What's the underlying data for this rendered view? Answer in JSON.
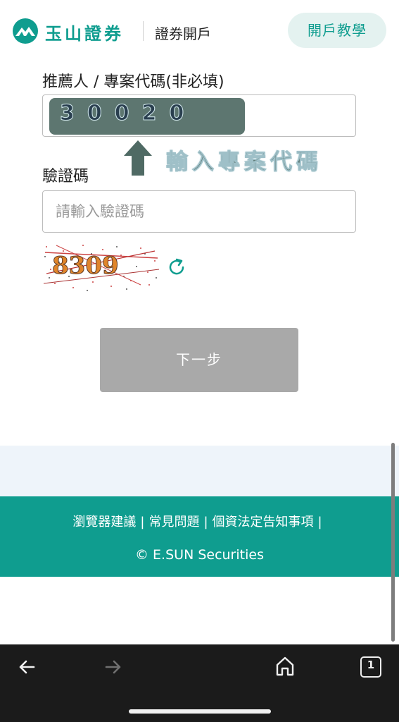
{
  "header": {
    "brand": "玉山證券",
    "subtitle": "證券開戶",
    "tutorial_button": "開戶教學"
  },
  "form": {
    "referral_label": "推薦人 / 專案代碼(非必填)",
    "referral_value": "30020",
    "annotation": "輸入專案代碼",
    "captcha_label": "驗證碼",
    "captcha_placeholder": "請輸入驗證碼",
    "captcha_image_text": "8309",
    "next_button": "下一步"
  },
  "footer": {
    "links": [
      "瀏覽器建議",
      "常見問題",
      "個資法定告知事項"
    ],
    "copyright": "© E.SUN Securities"
  },
  "browser": {
    "tabs_count": "1"
  },
  "icons": {
    "logo": "mountain-logo-icon",
    "annotation_arrow": "arrow-up-icon",
    "refresh": "refresh-icon",
    "back": "arrow-left-icon",
    "forward": "arrow-right-icon",
    "home": "home-icon",
    "tabs": "tabs-icon"
  },
  "colors": {
    "brand": "#0f9d8f",
    "button_disabled": "#a9a9a9",
    "annotation": "#4f6a64"
  }
}
